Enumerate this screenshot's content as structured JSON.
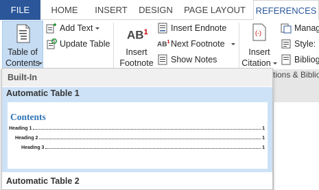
{
  "ribbon_tabs": {
    "file": "FILE",
    "home": "HOME",
    "insert": "INSERT",
    "design": "DESIGN",
    "page_layout": "PAGE LAYOUT",
    "references": "REFERENCES"
  },
  "active_tab": "REFERENCES",
  "toc_group": {
    "toc_button_line1": "Table of",
    "toc_button_line2": "Contents",
    "add_text": "Add Text",
    "update_table": "Update Table"
  },
  "footnotes_group": {
    "insert_footnote_line1": "Insert",
    "insert_footnote_line2": "Footnote",
    "footnote_icon_text": "AB",
    "footnote_icon_sup": "1",
    "insert_endnote": "Insert Endnote",
    "next_footnote": "Next Footnote",
    "show_notes": "Show Notes",
    "next_icon_text": "AB",
    "next_icon_sup": "1"
  },
  "citations_group": {
    "insert_citation_line1": "Insert",
    "insert_citation_line2": "Citation",
    "manage_sources": "Manag",
    "style": "Style:",
    "bibliography": "Bibliog",
    "group_label": "tions & Bibliog"
  },
  "gallery": {
    "section": "Built-In",
    "item1_title": "Automatic Table 1",
    "item1_preview": {
      "heading": "Contents",
      "entries": [
        {
          "text": "Heading 1",
          "page": "1"
        },
        {
          "text": "Heading 2",
          "page": "1"
        },
        {
          "text": "Heading 3",
          "page": "1"
        }
      ]
    },
    "item2_title": "Automatic Table 2"
  },
  "colors": {
    "file_tab": "#2b579a",
    "active_tab_text": "#2b579a",
    "hover_highlight": "#cde2f6",
    "toc_button_pressed": "#c5dcf3",
    "preview_heading": "#2e74b5",
    "footnote_sup": "#c00000"
  },
  "icons": {
    "toc": "table-of-contents-icon",
    "add_text": "add-text-icon",
    "update_table": "update-table-icon",
    "insert_footnote": "footnote-icon",
    "insert_endnote": "endnote-icon",
    "next_footnote": "next-footnote-icon",
    "show_notes": "show-notes-icon",
    "insert_citation": "citation-icon",
    "manage_sources": "manage-sources-icon",
    "style": "style-icon",
    "bibliography": "bibliography-icon"
  }
}
